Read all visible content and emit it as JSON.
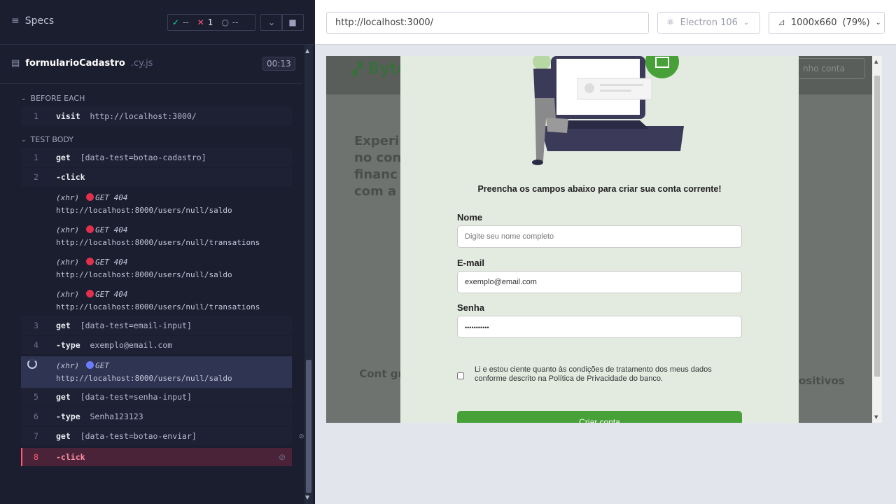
{
  "reporter": {
    "specs_label": "Specs",
    "stats": {
      "passed": "--",
      "failed": "1",
      "pending": "--"
    },
    "file": {
      "name": "formularioCadastro",
      "ext": ".cy.js",
      "duration": "00:13"
    },
    "before_each": {
      "label": "BEFORE EACH",
      "commands": [
        {
          "num": "1",
          "name": "visit",
          "arg": "http://localhost:3000/"
        }
      ]
    },
    "test_body": {
      "label": "TEST BODY",
      "commands": [
        {
          "num": "1",
          "name": "get",
          "arg": "[data-test=botao-cadastro]"
        },
        {
          "num": "2",
          "name": "-click",
          "arg": ""
        },
        {
          "num": "3",
          "name": "get",
          "arg": "[data-test=email-input]"
        },
        {
          "num": "4",
          "name": "-type",
          "arg": "exemplo@email.com"
        },
        {
          "num": "5",
          "name": "get",
          "arg": "[data-test=senha-input]"
        },
        {
          "num": "6",
          "name": "-type",
          "arg": "Senha123123"
        },
        {
          "num": "7",
          "name": "get",
          "arg": "[data-test=botao-enviar]"
        },
        {
          "num": "8",
          "name": "-click",
          "arg": ""
        }
      ],
      "xhr": [
        {
          "kind": "(xhr)",
          "method": "GET 404",
          "url": "http://localhost:8000/users/null/saldo",
          "status_color": "#e0304e"
        },
        {
          "kind": "(xhr)",
          "method": "GET 404",
          "url": "http://localhost:8000/users/null/transations",
          "status_color": "#e0304e"
        },
        {
          "kind": "(xhr)",
          "method": "GET 404",
          "url": "http://localhost:8000/users/null/saldo",
          "status_color": "#e0304e"
        },
        {
          "kind": "(xhr)",
          "method": "GET 404",
          "url": "http://localhost:8000/users/null/transations",
          "status_color": "#e0304e"
        },
        {
          "kind": "(xhr)",
          "method": "GET",
          "url": "http://localhost:8000/users/null/saldo",
          "status_color": "#6b7cff"
        }
      ]
    }
  },
  "aut": {
    "url": "http://localhost:3000/",
    "browser": "Electron 106",
    "viewport": "1000x660",
    "zoom": "(79%)"
  },
  "app": {
    "logo": "Byte",
    "header_button": "nho conta",
    "bg_text": "Experi no cont financ com a g",
    "bg_card_left": "Cont gra",
    "bg_card_right": "ositivos",
    "modal": {
      "title": "Preencha os campos abaixo para criar sua conta corrente!",
      "nome_label": "Nome",
      "nome_placeholder": "Digite seu nome completo",
      "email_label": "E-mail",
      "email_value": "exemplo@email.com",
      "senha_label": "Senha",
      "senha_value": "•••••••••••",
      "consent": "Li e estou ciente quanto às condições de tratamento dos meus dados conforme descrito na Política de Privacidade do banco.",
      "submit": "Criar conta"
    }
  },
  "colors": {
    "pass": "#1fd698",
    "fail": "#ff5a7a",
    "brand_green": "#47a138"
  }
}
